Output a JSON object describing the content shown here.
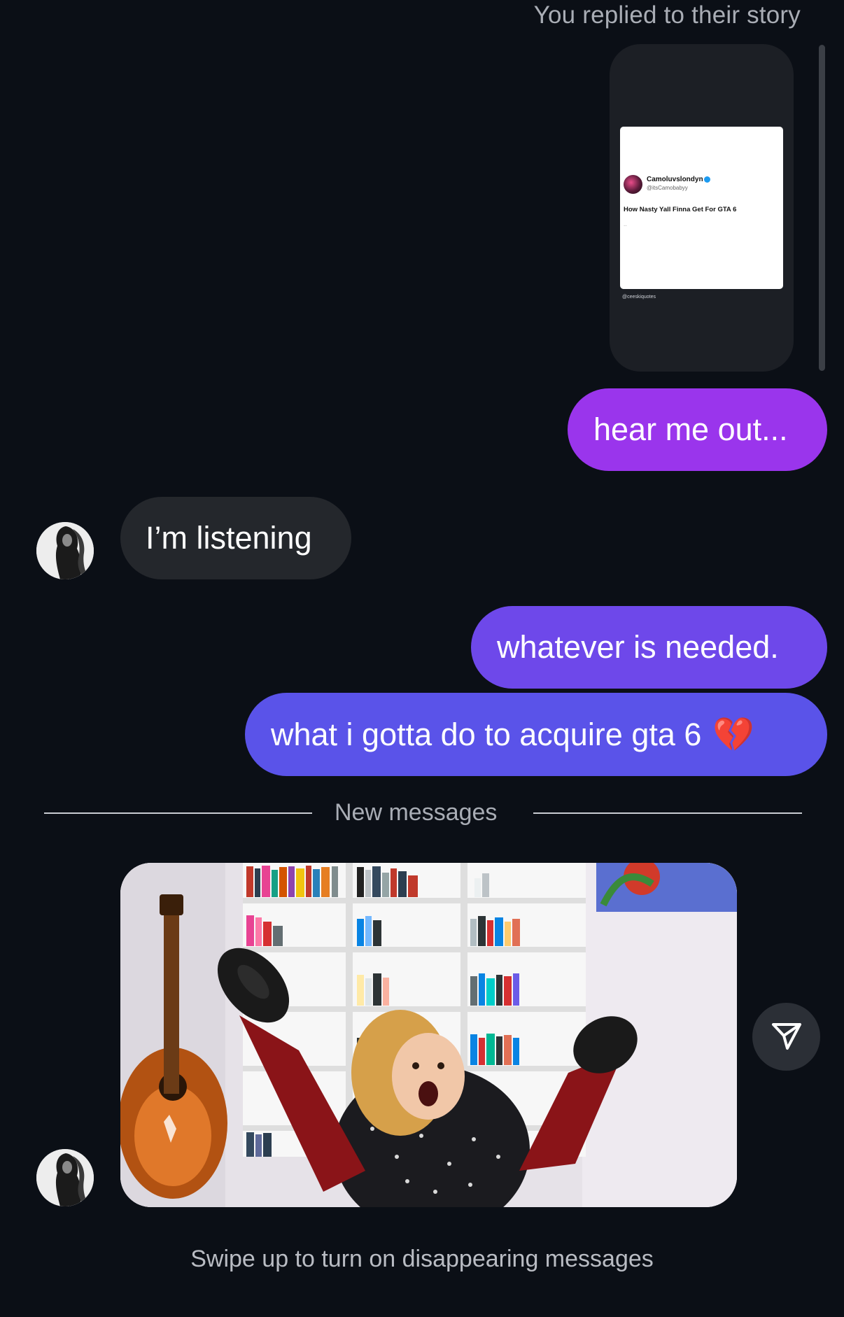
{
  "story_reply": {
    "caption": "You replied to their story",
    "tweet": {
      "name": "Camoluvslondyn",
      "handle": "@itsCamobabyy",
      "text": "How Nasty Yall Finna Get For GTA 6",
      "dots": "..",
      "watermark": "@ceeskiquotes"
    }
  },
  "messages": [
    {
      "id": "m1",
      "sender": "me",
      "text": "hear me out...",
      "color": "#9a35ec"
    },
    {
      "id": "m2",
      "sender": "them",
      "text": "I’m listening",
      "color": "#24272c"
    },
    {
      "id": "m3",
      "sender": "me",
      "text": "whatever is needed.",
      "color": "#6e48ea"
    },
    {
      "id": "m4",
      "sender": "me",
      "text": "what i gotta do to acquire gta 6",
      "emoji": "💔",
      "color": "#5a53e9"
    }
  ],
  "divider": {
    "label": "New messages"
  },
  "media": {
    "type": "gif",
    "share_icon": "send-icon"
  },
  "footer": {
    "text": "Swipe up to turn on disappearing messages"
  },
  "colors": {
    "background": "#0b0f16",
    "muted_text": "#a9adb5"
  }
}
